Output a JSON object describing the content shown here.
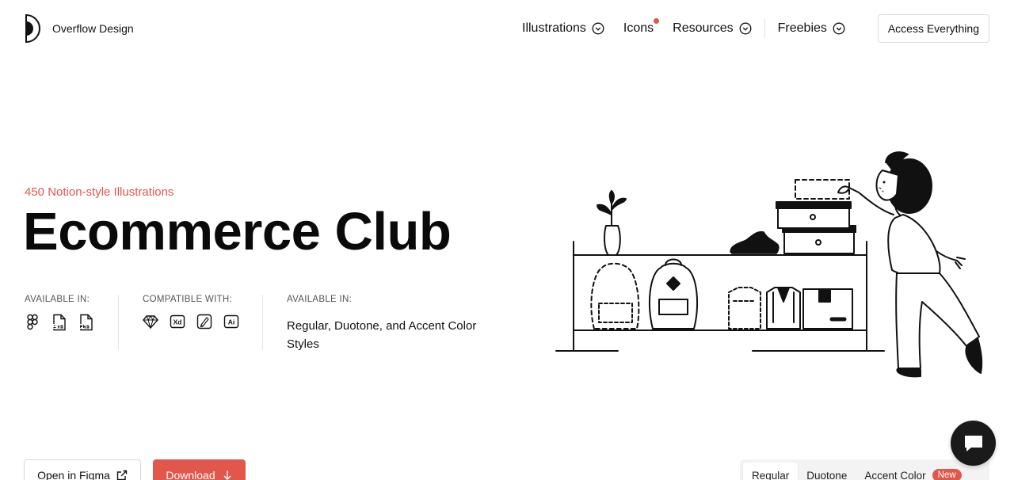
{
  "brand": {
    "name": "Overflow Design",
    "logo_icon": "half-moon-logo-icon"
  },
  "nav": {
    "items": [
      {
        "label": "Illustrations",
        "icon": "chevron-down-circle-icon"
      },
      {
        "label": "Icons",
        "indicator": "red-dot"
      },
      {
        "label": "Resources",
        "icon": "chevron-down-circle-icon"
      },
      {
        "label": "Freebies",
        "icon": "chevron-down-circle-icon"
      }
    ],
    "cta": "Access Everything"
  },
  "hero": {
    "eyebrow": "450 Notion-style Illustrations",
    "title": "Ecommerce Club"
  },
  "meta": {
    "formats_label": "AVAILABLE IN:",
    "formats": [
      "figma-icon",
      "svg-file-icon",
      "png-file-icon"
    ],
    "compat_label": "COMPATIBLE WITH:",
    "compat": [
      "sketch-icon",
      "xd-icon",
      "affinity-pen-icon",
      "illustrator-icon"
    ],
    "styles_label": "AVAILABLE IN:",
    "styles_text": "Regular, Duotone, and Accent Color Styles"
  },
  "actions": {
    "figma": "Open in Figma",
    "download": "Download"
  },
  "style_tabs": {
    "tabs": [
      "Regular",
      "Duotone",
      "Accent Color"
    ],
    "active": "Regular",
    "badge": "New"
  },
  "colors": {
    "accent": "#e2574c",
    "text": "#111111",
    "chat": "#1a1a1a"
  }
}
